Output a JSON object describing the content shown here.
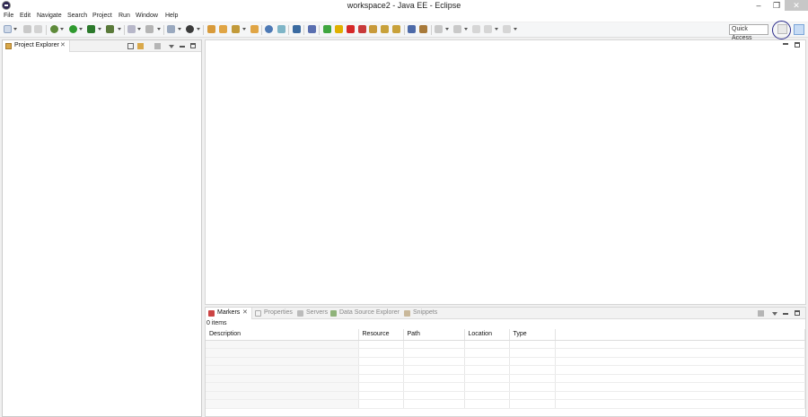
{
  "window": {
    "title": "workspace2 - Java EE - Eclipse"
  },
  "menu": [
    "File",
    "Edit",
    "Navigate",
    "Search",
    "Project",
    "Run",
    "Window",
    "Help"
  ],
  "toolbar": {
    "quick_access": "Quick Access",
    "icons": [
      "new-icon",
      "save-icon",
      "save-all-icon",
      "debug-settings-icon",
      "run-icon",
      "run-coverage-icon",
      "external-tools-icon",
      "open-type-icon",
      "new-server-icon",
      "open-task-icon",
      "web-browser-icon",
      "deploy-icon",
      "package-icon",
      "search-icon",
      "next-annotation-icon",
      "skip-breakpoints-icon",
      "resume-icon",
      "suspend-icon",
      "terminate-icon",
      "disconnect-icon",
      "step-into-icon",
      "step-over-icon",
      "step-return-icon",
      "drop-to-frame-icon",
      "use-step-filters-icon",
      "next-edit-icon",
      "prev-edit-icon",
      "back-icon",
      "forward-icon"
    ]
  },
  "explorer": {
    "tab_label": "Project Explorer"
  },
  "markers": {
    "tabs": [
      {
        "label": "Markers",
        "active": true
      },
      {
        "label": "Properties",
        "active": false
      },
      {
        "label": "Servers",
        "active": false
      },
      {
        "label": "Data Source Explorer",
        "active": false
      },
      {
        "label": "Snippets",
        "active": false
      }
    ],
    "count": "0 items",
    "columns": [
      "Description",
      "Resource",
      "Path",
      "Location",
      "Type",
      ""
    ]
  },
  "colors": {
    "accent": "#7aa4d8",
    "annotation_circle": "#2a2a8a"
  }
}
